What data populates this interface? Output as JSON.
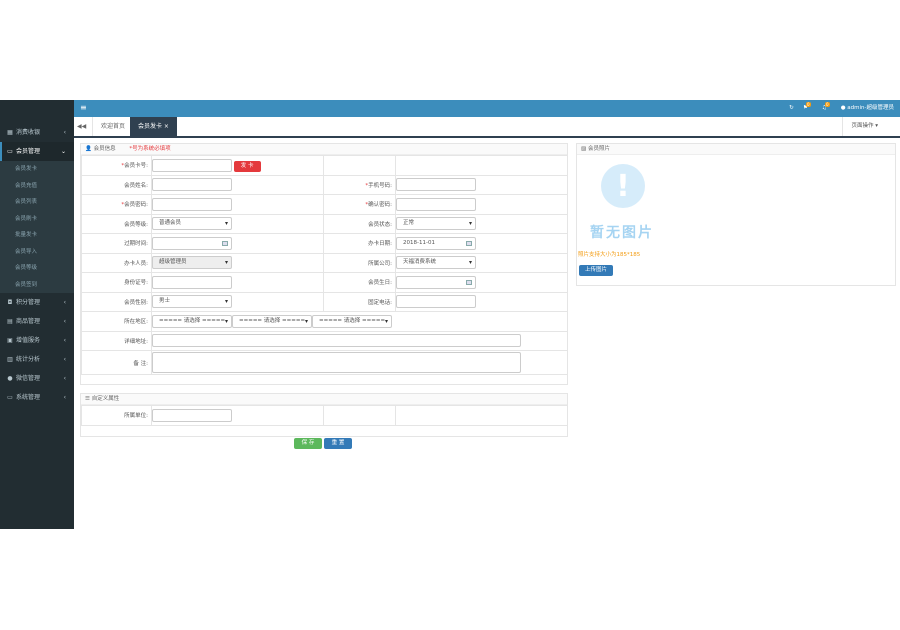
{
  "topbar": {
    "menu_icon": "bars-icon",
    "user": "admin-超级管理员",
    "badges": [
      "0",
      "0"
    ]
  },
  "sidebar": {
    "items": [
      {
        "label": "消费收银",
        "icon": "cart-icon"
      },
      {
        "label": "会员管理",
        "icon": "card-icon"
      }
    ],
    "subitems": [
      "会员发卡",
      "会员充值",
      "会员列表",
      "会员刷卡",
      "批量发卡",
      "会员导入",
      "会员等级",
      "会员签到"
    ],
    "items2": [
      {
        "label": "积分管理",
        "icon": "gift-icon"
      },
      {
        "label": "商品管理",
        "icon": "box-icon"
      },
      {
        "label": "增值服务",
        "icon": "money-icon"
      },
      {
        "label": "统计分析",
        "icon": "chart-icon"
      },
      {
        "label": "微信管理",
        "icon": "wechat-icon"
      },
      {
        "label": "系统管理",
        "icon": "desktop-icon"
      }
    ]
  },
  "tabs": {
    "nav": "◀◀",
    "home": "欢迎首页",
    "active": "会员发卡 ×",
    "page_ops": "页面操作 ▾"
  },
  "member_info": {
    "title": "会员信息",
    "required_note": "*号为系统必填项",
    "issue_btn": "发 卡",
    "labels": {
      "card_no": "会员卡号:",
      "name": "会员姓名:",
      "phone": "手机号码:",
      "password": "会员密码:",
      "confirm_password": "确认密码:",
      "level": "会员等级:",
      "status": "会员状态:",
      "expiry": "过期时间:",
      "issue_date": "办卡日期:",
      "operator": "办卡人员:",
      "company": "所属公司:",
      "id_no": "身份证号:",
      "birthday": "会员生日:",
      "gender": "会员性别:",
      "landline": "固定电话:",
      "region": "所在地区:",
      "address": "详细地址:",
      "remark": "备 注:"
    },
    "values": {
      "level": "普通会员",
      "status": "正常",
      "issue_date": "2018-11-01",
      "operator": "超级管理员",
      "company": "天福消费系统",
      "gender": "男士",
      "region_placeholder": "===== 请选择 ====="
    }
  },
  "custom_attrs": {
    "title": "自定义属性",
    "label": "所属单位:"
  },
  "actions": {
    "save": "保 存",
    "reset": "重 置"
  },
  "photo": {
    "title": "会员照片",
    "no_image": "暂无图片",
    "hint": "照片支持大小为185*185",
    "upload": "上传图片"
  }
}
